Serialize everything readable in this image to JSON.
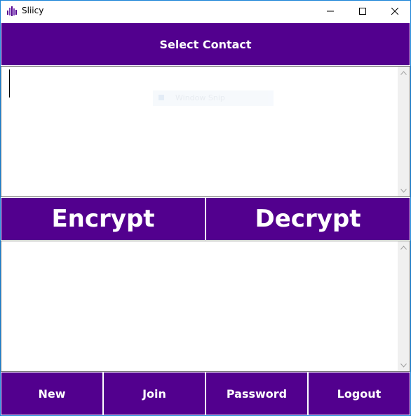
{
  "window": {
    "title": "Sliicy",
    "icon": "sliicy-app-icon"
  },
  "header": {
    "select_contact_label": "Select Contact"
  },
  "input": {
    "ghost_overlay_text": "Window Snip"
  },
  "actions": {
    "encrypt_label": "Encrypt",
    "decrypt_label": "Decrypt"
  },
  "footer": {
    "new_label": "New",
    "join_label": "Join",
    "password_label": "Password",
    "logout_label": "Logout"
  },
  "colors": {
    "accent": "#52008e",
    "window_border": "#1883d7",
    "button_text": "#ffffff"
  }
}
